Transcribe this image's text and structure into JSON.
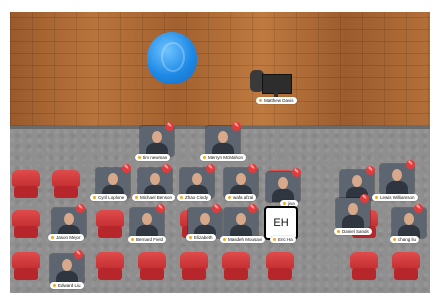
{
  "participants": {
    "matthew": "Matthew Davis",
    "tim": "tim newman",
    "merryn": "Merryn McMahon",
    "cyril": "Cyril Loplone",
    "michael": "Michael Benson",
    "zhao": "Zhao Cindy",
    "wafa": "wafa afzal",
    "jiva": "jiva",
    "jason": "Jason Mejor",
    "bernard": "Bernard Field",
    "elizabeth": "Elizabeth",
    "mesdeh": "Masdeh Mousavi",
    "eric": "Eric Ha",
    "lewis": "Lewis Williamson",
    "daniel": "Daniel Sands",
    "chang": "chang liu",
    "edward": "Edward Liu"
  },
  "avatar_initials": "EH",
  "badge_glyph": "✎",
  "colors": {
    "badge": "#e23b3b",
    "chair": "#c42f33",
    "beanbag": "#1f8ae6"
  }
}
